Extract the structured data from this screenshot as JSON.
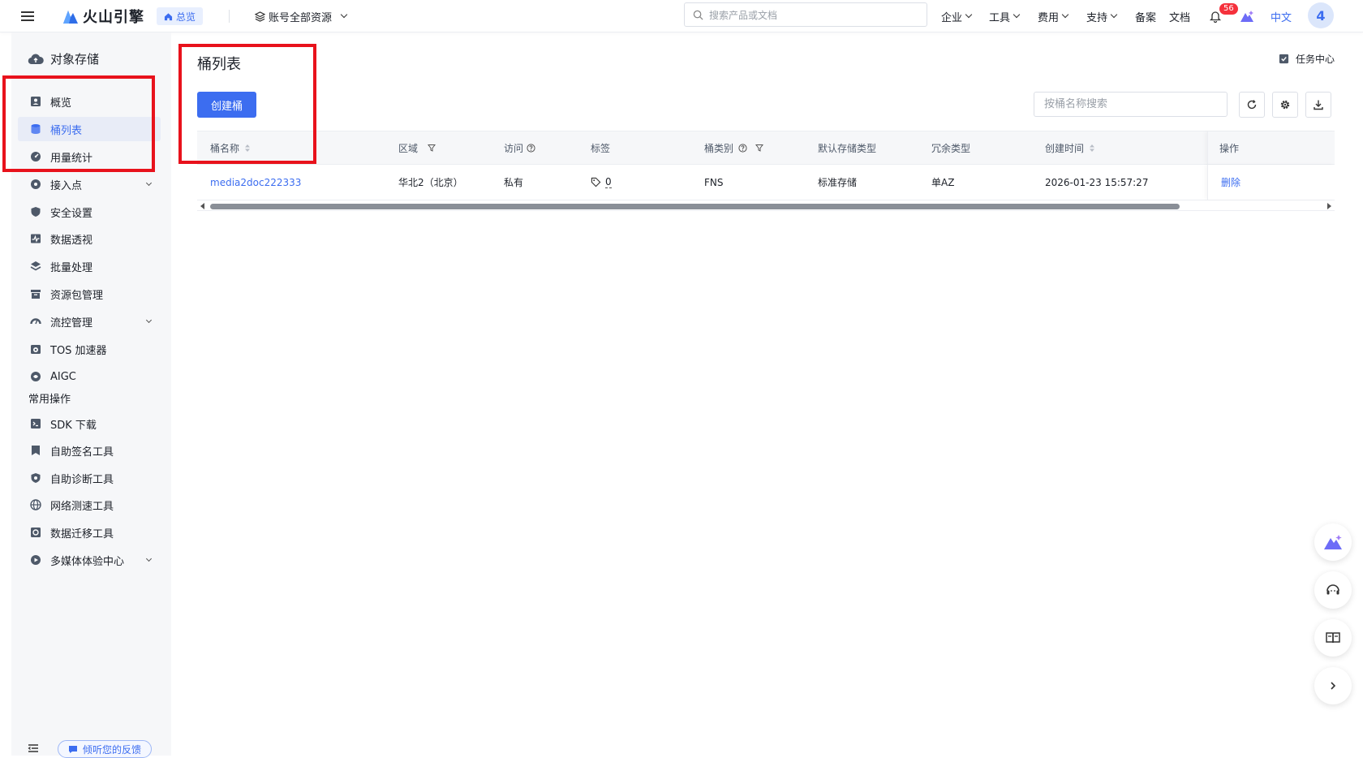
{
  "topbar": {
    "brand": "火山引擎",
    "home_label": "总览",
    "account_scope": "账号全部资源",
    "search_placeholder": "搜索产品或文档",
    "nav": [
      "企业",
      "工具",
      "费用",
      "支持",
      "备案",
      "文档"
    ],
    "notification_count": "56",
    "language": "中文",
    "avatar_initial": "4"
  },
  "sidebar": {
    "title": "对象存储",
    "items": [
      {
        "label": "概览",
        "icon": "overview-icon"
      },
      {
        "label": "桶列表",
        "icon": "bucket-icon",
        "active": true
      },
      {
        "label": "用量统计",
        "icon": "usage-icon"
      },
      {
        "label": "接入点",
        "icon": "access-point-icon",
        "expandable": true
      },
      {
        "label": "安全设置",
        "icon": "shield-icon"
      },
      {
        "label": "数据透视",
        "icon": "pulse-icon"
      },
      {
        "label": "批量处理",
        "icon": "layers-icon"
      },
      {
        "label": "资源包管理",
        "icon": "package-icon"
      },
      {
        "label": "流控管理",
        "icon": "gauge-icon",
        "expandable": true
      },
      {
        "label": "TOS 加速器",
        "icon": "accelerator-icon"
      },
      {
        "label": "AIGC",
        "icon": "aigc-icon"
      }
    ],
    "section_title": "常用操作",
    "common_items": [
      {
        "label": "SDK 下载",
        "icon": "terminal-icon"
      },
      {
        "label": "自助签名工具",
        "icon": "bookmark-icon"
      },
      {
        "label": "自助诊断工具",
        "icon": "diagnose-icon"
      },
      {
        "label": "网络测速工具",
        "icon": "globe-icon"
      },
      {
        "label": "数据迁移工具",
        "icon": "migrate-icon"
      },
      {
        "label": "多媒体体验中心",
        "icon": "media-icon",
        "expandable": true
      }
    ],
    "feedback_label": "倾听您的反馈"
  },
  "main": {
    "page_title": "桶列表",
    "task_center_label": "任务中心",
    "create_button": "创建桶",
    "search_placeholder": "按桶名称搜索",
    "table": {
      "headers": [
        "桶名称",
        "区域",
        "访问",
        "标签",
        "桶类别",
        "默认存储类型",
        "冗余类型",
        "创建时间",
        "操作"
      ],
      "rows": [
        {
          "name": "media2doc222333",
          "region": "华北2（北京）",
          "access": "私有",
          "tags": "0",
          "category": "FNS",
          "storage_class": "标准存储",
          "redundancy": "单AZ",
          "created": "2026-01-23 15:57:27",
          "action": "删除"
        }
      ]
    }
  },
  "colors": {
    "accent": "#3c6df0",
    "highlight": "#e8121c",
    "badge": "#f5313c"
  }
}
